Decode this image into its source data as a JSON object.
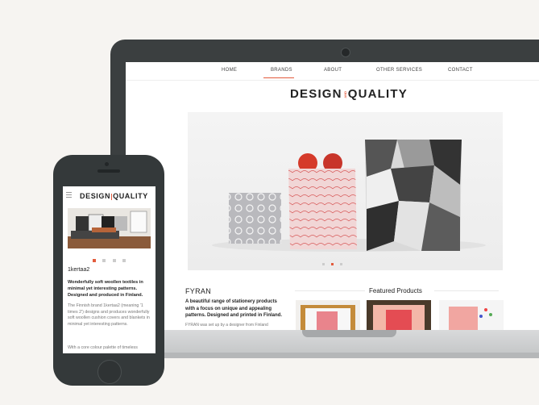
{
  "desktop": {
    "nav": [
      {
        "label": "HOME"
      },
      {
        "label": "BRANDS"
      },
      {
        "label": "ABOUT"
      },
      {
        "label": "OTHER SERVICES"
      },
      {
        "label": "CONTACT"
      }
    ],
    "active_nav": "BRANDS",
    "logo_left": "DESIGN",
    "logo_and": "AND",
    "logo_right": "QUALITY",
    "fyran": {
      "title": "FYRAN",
      "description": "A beautiful range of stationery products with a focus on unique and appealing patterns. Designed and printed in Finland.",
      "body": "FYRAN was set up by a designer from Finland"
    },
    "featured_title": "Featured Products",
    "colors": {
      "accent": "#e35b3c"
    }
  },
  "mobile": {
    "logo_left": "DESIGN",
    "logo_right": "QUALITY",
    "title": "1kertaa2",
    "description": "Wonderfully soft woollen textiles in minimal yet interesting patterns. Designed and produced in Finland.",
    "body": "The Finnish brand 1kertaa2 (meaning '1 times 2') designs and produces wonderfully soft woollen cushion covers and blankets in minimal yet interesting patterns.",
    "body2": "With a core colour palette of timeless"
  }
}
